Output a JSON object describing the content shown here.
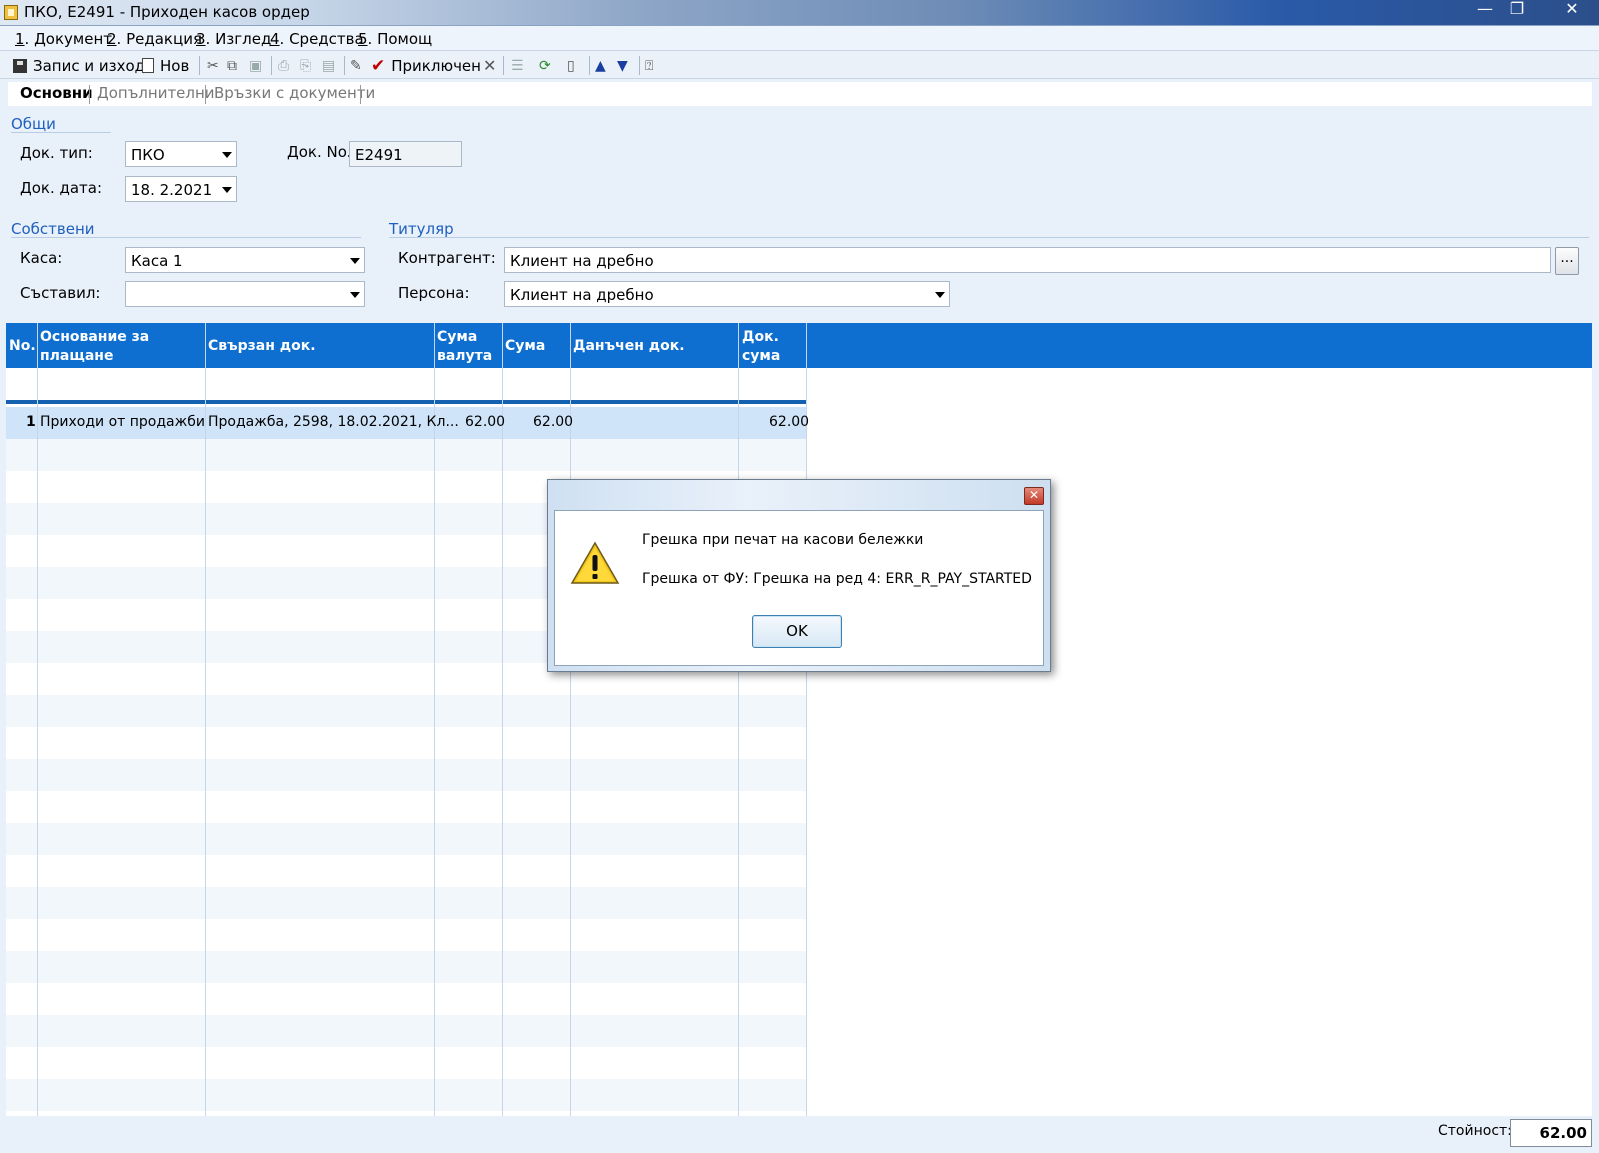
{
  "window": {
    "title": "ПКО, E2491 - Приходен касов ордер",
    "minimize": "—",
    "maximize": "❐",
    "close": "✕"
  },
  "menu": [
    {
      "num": "1",
      "label": ". Документ"
    },
    {
      "num": "2",
      "label": ". Редакция"
    },
    {
      "num": "3",
      "label": ". Изглед"
    },
    {
      "num": "4",
      "label": ". Средства"
    },
    {
      "num": "5",
      "label": ". Помощ"
    }
  ],
  "toolbar": {
    "save_exit": "Запис и изход",
    "new": "Нов",
    "finished": "Приключен"
  },
  "tabs": [
    "Основни",
    "Допълнителни",
    "Връзки с документи"
  ],
  "general": {
    "section": "Общи",
    "doc_type_label": "Док. тип:",
    "doc_type": "ПКО",
    "doc_no_label": "Док. No.",
    "doc_no": "E2491",
    "doc_date_label": "Док. дата:",
    "doc_date": "18.  2.2021"
  },
  "own": {
    "section": "Собствени",
    "cash_label": "Каса:",
    "cash": "Каса 1",
    "composer_label": "Съставил:",
    "composer": ""
  },
  "holder": {
    "section": "Титуляр",
    "counterparty_label": "Контрагент:",
    "counterparty": "Клиент на дребно",
    "ellipsis": "...",
    "person_label": "Персона:",
    "person": "Клиент на дребно"
  },
  "grid": {
    "headers": {
      "no": "No.",
      "reason_1": "Основание за",
      "reason_2": "плащане",
      "linked_doc": "Свързан док.",
      "cur_sum_1": "Сума",
      "cur_sum_2": "валута",
      "sum": "Сума",
      "tax_doc": "Данъчен док.",
      "doc_sum_1": "Док.",
      "doc_sum_2": "сума"
    },
    "rows": [
      {
        "no": "1",
        "reason": "Приходи от продажби",
        "linked_doc": "Продажба, 2598, 18.02.2021, Кл...",
        "cur_sum": "62.00",
        "sum": "62.00",
        "tax_doc": "",
        "doc_sum": "62.00"
      }
    ]
  },
  "footer": {
    "value_label": "Стойност:",
    "value": "62.00"
  },
  "dialog": {
    "close": "✕",
    "line1": "Грешка при печат на касови бележки",
    "line2": "Грешка от ФУ: Грешка на ред 4: ERR_R_PAY_STARTED",
    "ok": "OK"
  }
}
